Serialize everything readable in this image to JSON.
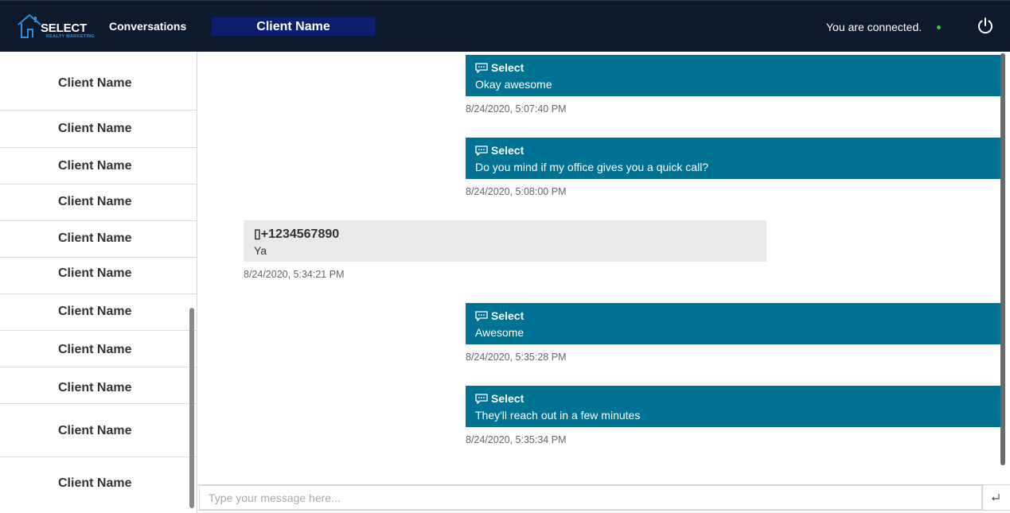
{
  "header": {
    "logo": {
      "word": "SELECT",
      "sub": "REALTY MARKETING"
    },
    "nav_conversations": "Conversations",
    "active_client": "Client Name",
    "status_text": "You are connected.",
    "status_color": "#2fd12f",
    "brand_color": "#0c1a2b",
    "tab_color": "#0e1e6e"
  },
  "sidebar": {
    "items": [
      {
        "label": "Client Name"
      },
      {
        "label": "Client Name"
      },
      {
        "label": "Client Name"
      },
      {
        "label": "Client Name"
      },
      {
        "label": "Client Name"
      },
      {
        "label": "Client Name"
      },
      {
        "label": "Client Name"
      },
      {
        "label": "Client Name"
      },
      {
        "label": "Client Name"
      },
      {
        "label": "Client Name"
      },
      {
        "label": "Client Name"
      }
    ]
  },
  "messages": [
    {
      "sender": "Select",
      "text": "Okay awesome",
      "time": "8/24/2020, 5:07:40 PM",
      "direction": "out"
    },
    {
      "sender": "Select",
      "text": "Do you mind if my office gives you a quick call?",
      "time": "8/24/2020, 5:08:00 PM",
      "direction": "out"
    },
    {
      "sender": "▯+1234567890",
      "text": "Ya",
      "time": "8/24/2020, 5:34:21 PM",
      "direction": "in"
    },
    {
      "sender": "Select",
      "text": "Awesome",
      "time": "8/24/2020, 5:35:28 PM",
      "direction": "out"
    },
    {
      "sender": "Select",
      "text": "They'll reach out in a few minutes",
      "time": "8/24/2020, 5:35:34 PM",
      "direction": "out"
    }
  ],
  "composer": {
    "placeholder": "Type your message here...",
    "value": ""
  },
  "colors": {
    "outgoing_bubble": "#007293",
    "incoming_bubble": "#e9e9e9"
  }
}
